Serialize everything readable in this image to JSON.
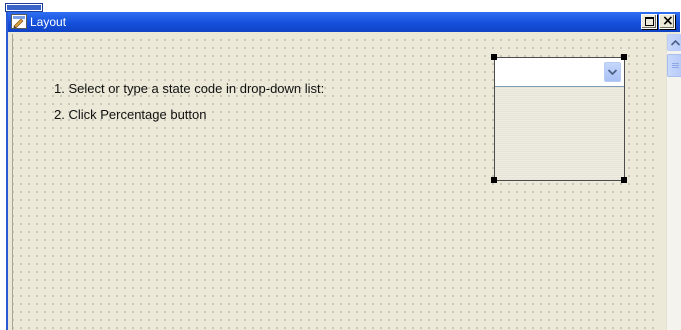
{
  "window": {
    "title": "Layout",
    "title_icon": "layout-form-icon",
    "buttons": {
      "maximize_icon": "maximize-icon",
      "close_glyph": "×"
    }
  },
  "instructions": {
    "line1": "1. Select or type a state code in drop-down list:",
    "line2": "2. Click Percentage button"
  },
  "combo": {
    "value": "",
    "arrow_icon": "chevron-down-icon"
  },
  "scrollbar": {
    "up_icon": "scroll-up-arrow-icon"
  },
  "colors": {
    "titlebar": "#1550dc",
    "canvas": "#ece9d8",
    "grid_dot": "#7a776c"
  }
}
